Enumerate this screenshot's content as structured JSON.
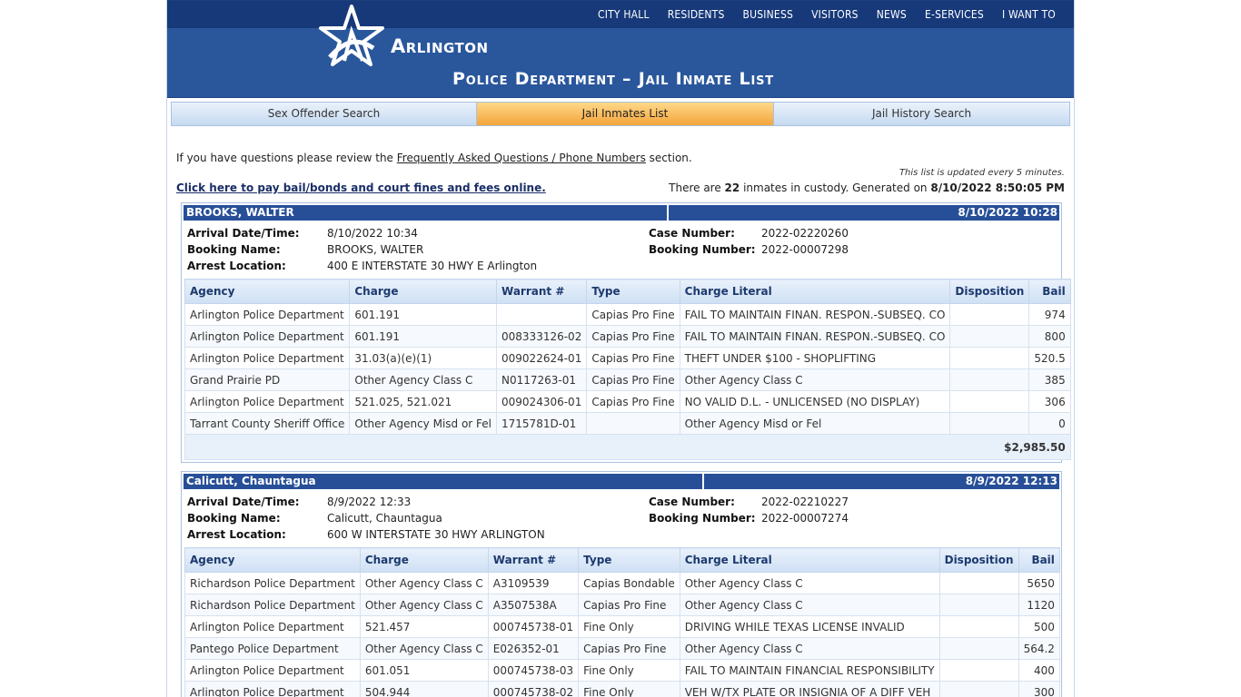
{
  "nav": {
    "top": [
      "CITY HALL",
      "RESIDENTS",
      "BUSINESS",
      "VISITORS",
      "NEWS",
      "E-SERVICES",
      "I WANT TO"
    ]
  },
  "header": {
    "logo_text": "Arlington",
    "title": "Police Department – Jail Inmate List"
  },
  "tabs": [
    {
      "label": "Sex Offender Search",
      "active": false
    },
    {
      "label": "Jail Inmates List",
      "active": true
    },
    {
      "label": "Jail History Search",
      "active": false
    }
  ],
  "intro": {
    "prefix": "If you have questions please review the ",
    "link": "Frequently Asked Questions / Phone Numbers",
    "suffix": " section."
  },
  "updated_note": "This list is updated every 5 minutes.",
  "pay_link": "Click here to pay bail/bonds and court fines and fees online.",
  "custody": {
    "prefix": "There are ",
    "count": "22",
    "middle": " inmates in custody. Generated on ",
    "generated": "8/10/2022 8:50:05 PM"
  },
  "labels": {
    "arrival": "Arrival Date/Time:",
    "booking_name": "Booking Name:",
    "arrest_location": "Arrest Location:",
    "case_number": "Case Number:",
    "booking_number": "Booking Number:"
  },
  "columns": [
    "Agency",
    "Charge",
    "Warrant #",
    "Type",
    "Charge Literal",
    "Disposition",
    "Bail"
  ],
  "inmates": [
    {
      "name": "BROOKS, WALTER",
      "date": "8/10/2022 10:28",
      "arrival": "8/10/2022 10:34",
      "booking_name": "BROOKS, WALTER",
      "arrest_location": "400 E INTERSTATE 30 HWY E Arlington",
      "case_number": "2022-02220260",
      "booking_number": "2022-00007298",
      "total": "$2,985.50",
      "charges": [
        {
          "agency": "Arlington Police Department",
          "charge": "601.191",
          "warrant": "",
          "type": "Capias Pro Fine",
          "literal": "FAIL TO MAINTAIN FINAN. RESPON.-SUBSEQ. CO",
          "disposition": "",
          "bail": "974"
        },
        {
          "agency": "Arlington Police Department",
          "charge": "601.191",
          "warrant": "008333126-02",
          "type": "Capias Pro Fine",
          "literal": "FAIL TO MAINTAIN FINAN. RESPON.-SUBSEQ. CO",
          "disposition": "",
          "bail": "800"
        },
        {
          "agency": "Arlington Police Department",
          "charge": "31.03(a)(e)(1)",
          "warrant": "009022624-01",
          "type": "Capias Pro Fine",
          "literal": "THEFT UNDER $100 - SHOPLIFTING",
          "disposition": "",
          "bail": "520.5"
        },
        {
          "agency": "Grand Prairie PD",
          "charge": "Other Agency Class C",
          "warrant": "N0117263-01",
          "type": "Capias Pro Fine",
          "literal": "Other Agency Class C",
          "disposition": "",
          "bail": "385"
        },
        {
          "agency": "Arlington Police Department",
          "charge": "521.025, 521.021",
          "warrant": "009024306-01",
          "type": "Capias Pro Fine",
          "literal": "NO VALID D.L. - UNLICENSED (NO DISPLAY)",
          "disposition": "",
          "bail": "306"
        },
        {
          "agency": "Tarrant County Sheriff Office",
          "charge": "Other Agency Misd or Fel",
          "warrant": "1715781D-01",
          "type": "",
          "literal": "Other Agency Misd or Fel",
          "disposition": "",
          "bail": "0"
        }
      ]
    },
    {
      "name": "Calicutt, Chauntagua",
      "date": "8/9/2022 12:13",
      "arrival": "8/9/2022 12:33",
      "booking_name": "Calicutt, Chauntagua",
      "arrest_location": "600 W INTERSTATE 30 HWY ARLINGTON",
      "case_number": "2022-02210227",
      "booking_number": "2022-00007274",
      "total": "",
      "charges": [
        {
          "agency": "Richardson Police Department",
          "charge": "Other Agency Class C",
          "warrant": "A3109539",
          "type": "Capias Bondable",
          "literal": "Other Agency Class C",
          "disposition": "",
          "bail": "5650"
        },
        {
          "agency": "Richardson Police Department",
          "charge": "Other Agency Class C",
          "warrant": "A3507538A",
          "type": "Capias Pro Fine",
          "literal": "Other Agency Class C",
          "disposition": "",
          "bail": "1120"
        },
        {
          "agency": "Arlington Police Department",
          "charge": "521.457",
          "warrant": "000745738-01",
          "type": "Fine Only",
          "literal": "DRIVING WHILE TEXAS LICENSE INVALID",
          "disposition": "",
          "bail": "500"
        },
        {
          "agency": "Pantego Police Department",
          "charge": "Other Agency Class C",
          "warrant": "E026352-01",
          "type": "Capias Pro Fine",
          "literal": "Other Agency Class C",
          "disposition": "",
          "bail": "564.2"
        },
        {
          "agency": "Arlington Police Department",
          "charge": "601.051",
          "warrant": "000745738-03",
          "type": "Fine Only",
          "literal": "FAIL TO MAINTAIN FINANCIAL RESPONSIBILITY",
          "disposition": "",
          "bail": "400"
        },
        {
          "agency": "Arlington Police Department",
          "charge": "504.944",
          "warrant": "000745738-02",
          "type": "Fine Only",
          "literal": "VEH W/TX PLATE OR INSIGNIA OF A DIFF VEH",
          "disposition": "",
          "bail": "300"
        }
      ]
    }
  ]
}
